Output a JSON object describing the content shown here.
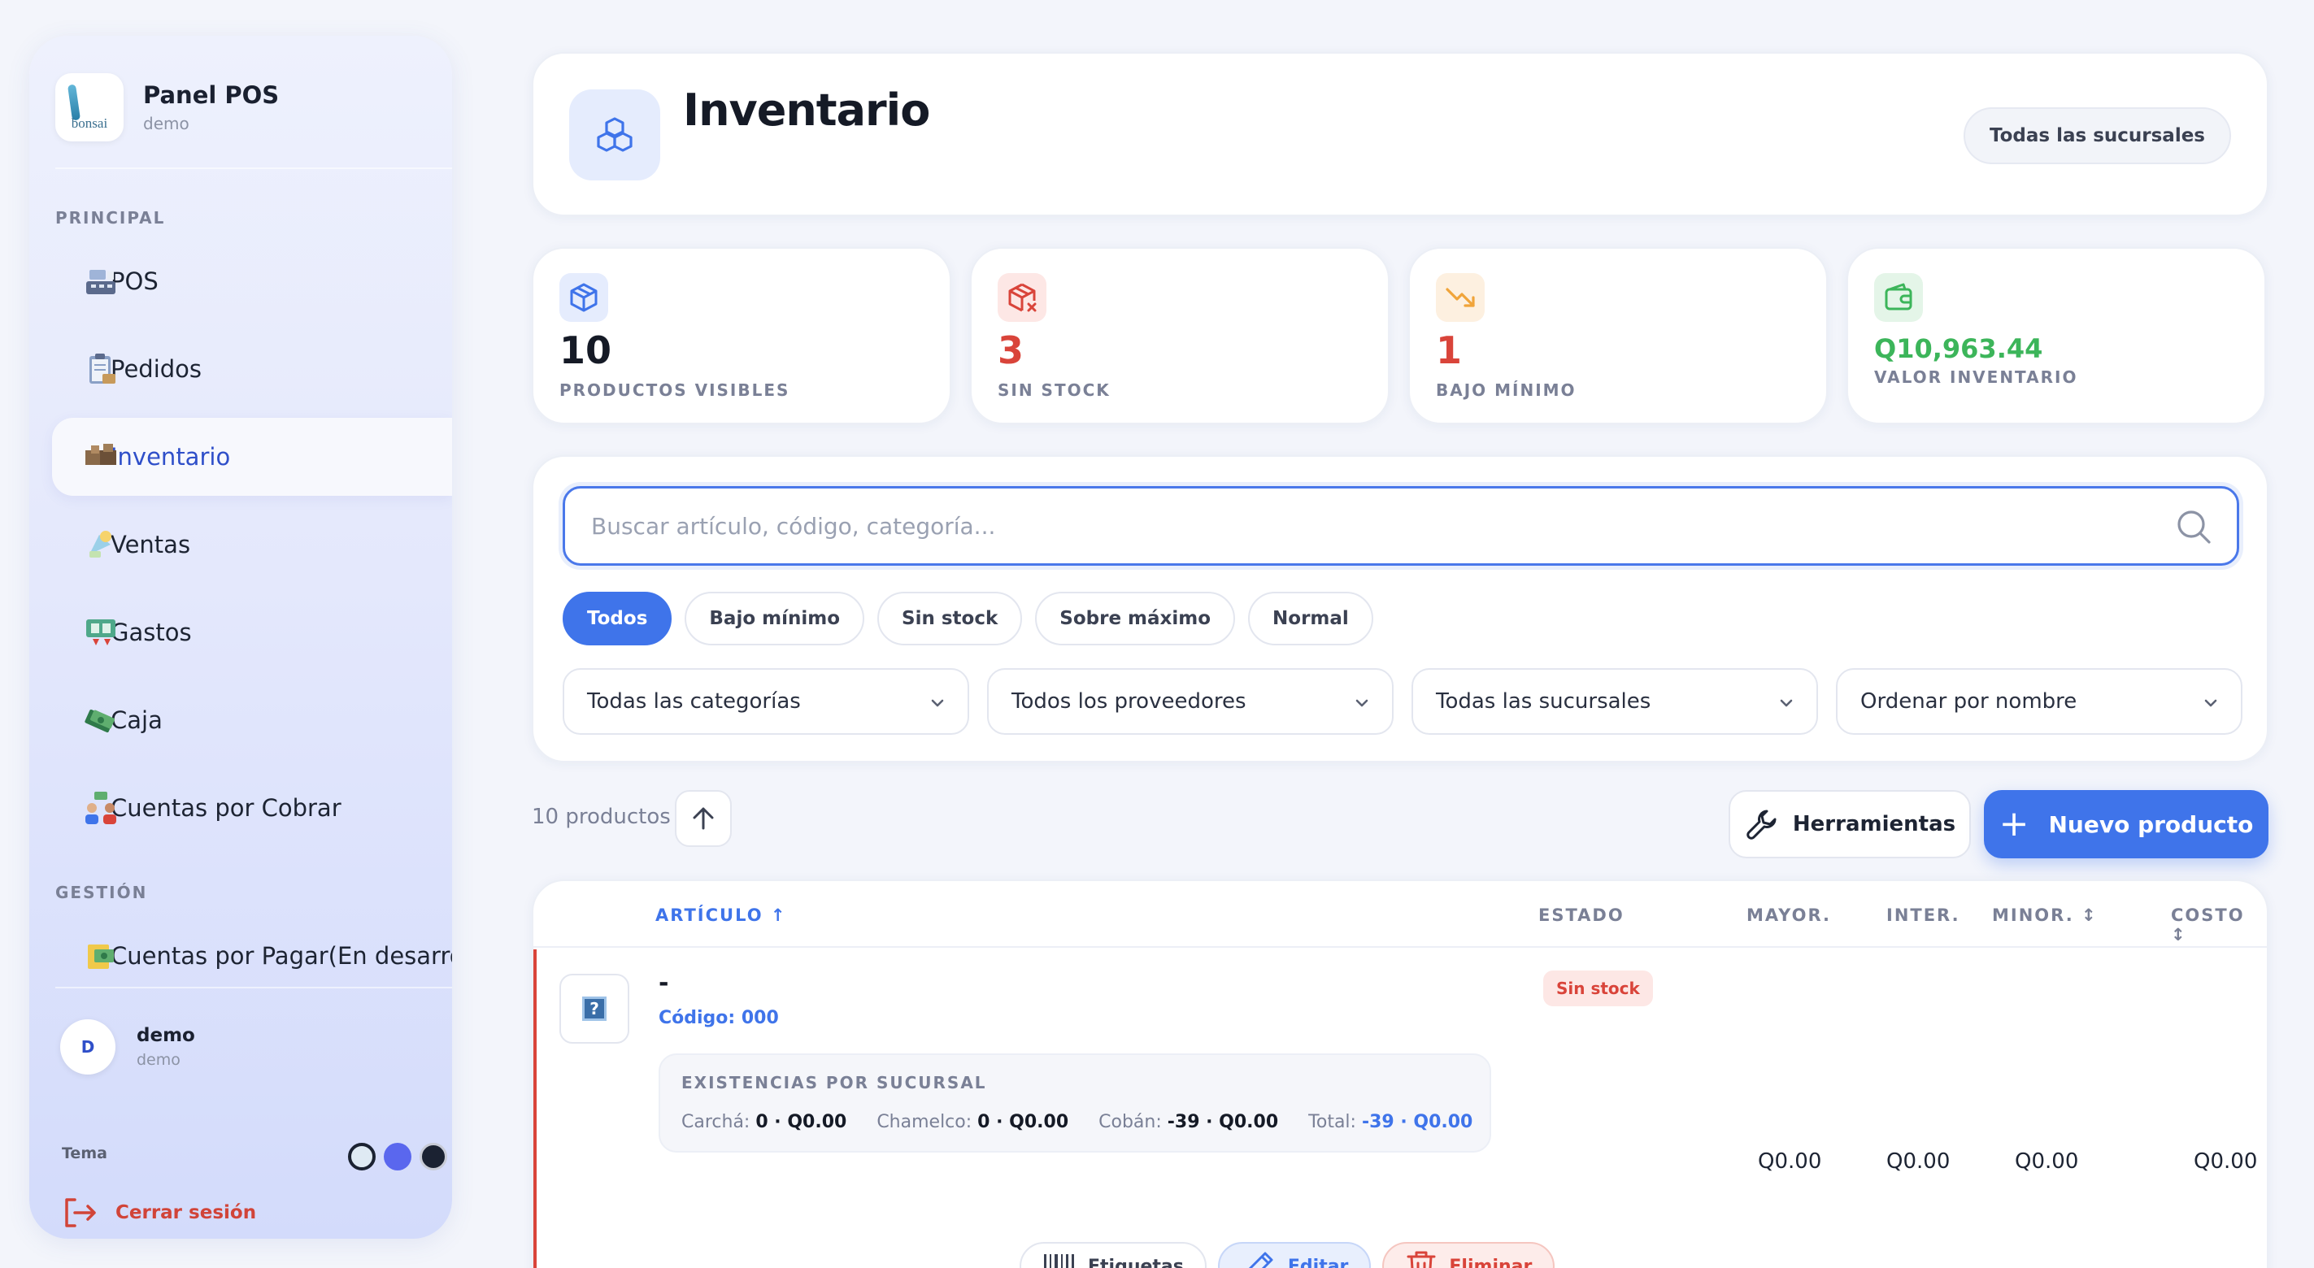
{
  "sidebar": {
    "brand_title": "Panel POS",
    "brand_sub": "demo",
    "logo_word": "bonsai",
    "section_principal": "PRINCIPAL",
    "section_gestion": "GESTIÓN",
    "items": [
      {
        "label": "POS",
        "icon": "pos-register-icon"
      },
      {
        "label": "Pedidos",
        "icon": "clipboard-icon"
      },
      {
        "label": "Inventario",
        "icon": "boxes-icon",
        "active": true
      },
      {
        "label": "Ventas",
        "icon": "sales-icon"
      },
      {
        "label": "Gastos",
        "icon": "expenses-icon"
      },
      {
        "label": "Caja",
        "icon": "cash-icon"
      },
      {
        "label": "Cuentas por Cobrar",
        "icon": "receivables-icon"
      },
      {
        "label": "Cuentas por Pagar(En desarro",
        "icon": "payables-icon"
      }
    ],
    "user": {
      "initial": "D",
      "name": "demo",
      "sub": "demo"
    },
    "theme_label": "Tema",
    "logout_label": "Cerrar sesión"
  },
  "header": {
    "title": "Inventario",
    "branch_label": "Todas las sucursales"
  },
  "stats": [
    {
      "value": "10",
      "label": "PRODUCTOS VISIBLES",
      "color": "#151a26"
    },
    {
      "value": "3",
      "label": "SIN STOCK",
      "color": "#d9443a"
    },
    {
      "value": "1",
      "label": "BAJO MÍNIMO",
      "color": "#d9443a"
    },
    {
      "value": "Q10,963.44",
      "label": "VALOR INVENTARIO",
      "color": "#3cb55a"
    }
  ],
  "filters": {
    "search_placeholder": "Buscar artículo, código, categoría...",
    "chips": [
      "Todos",
      "Bajo mínimo",
      "Sin stock",
      "Sobre máximo",
      "Normal"
    ],
    "selects": [
      "Todas las categorías",
      "Todos los proveedores",
      "Todas las sucursales",
      "Ordenar por nombre"
    ]
  },
  "toolbar": {
    "count_label": "10 productos",
    "tools_label": "Herramientas",
    "new_label": "Nuevo producto"
  },
  "table": {
    "headers": {
      "articulo": "ARTÍCULO ↑",
      "estado": "ESTADO",
      "mayor": "MAYOR.",
      "inter": "INTER.",
      "minor": "MINOR. ↕",
      "costo": "COSTO ↕"
    },
    "row": {
      "name": "-",
      "code": "Código: 000",
      "stock_title": "EXISTENCIAS POR SUCURSAL",
      "stock": {
        "carcha_label": "Carchá:",
        "carcha_value": "0 · Q0.00",
        "chamelco_label": "Chamelco:",
        "chamelco_value": "0 · Q0.00",
        "coban_label": "Cobán:",
        "coban_value": "-39 · Q0.00",
        "total_label": "Total:",
        "total_value": "-39 · Q0.00"
      },
      "status": "Sin stock",
      "mayor": "Q0.00",
      "inter": "Q0.00",
      "minor": "Q0.00",
      "costo": "Q0.00",
      "actions": {
        "labels": "Etiquetas",
        "edit": "Editar",
        "delete": "Eliminar"
      }
    }
  },
  "colors": {
    "accent": "#3f74ea",
    "danger": "#d9443a",
    "success": "#3cb55a",
    "warning": "#f0a43a"
  }
}
